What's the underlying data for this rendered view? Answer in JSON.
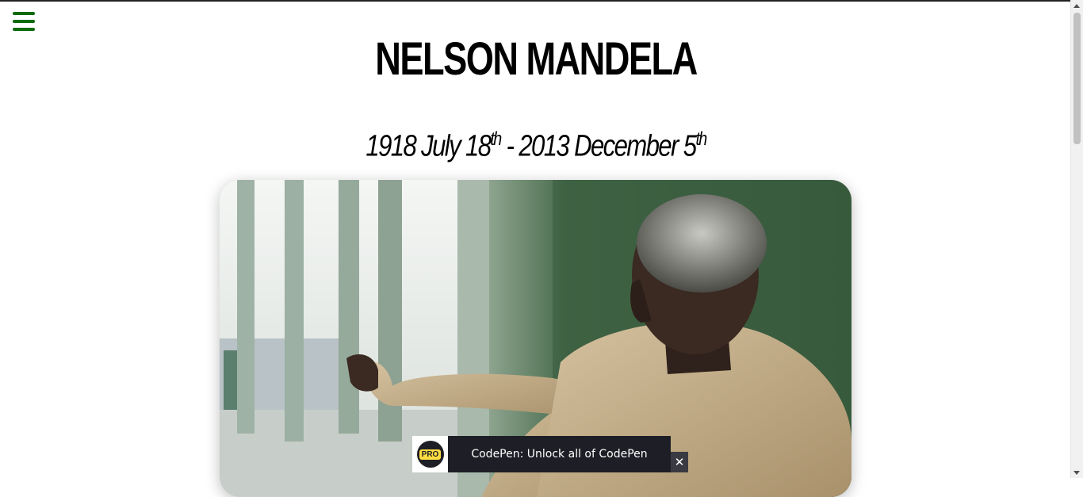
{
  "header": {
    "menu_icon": "hamburger-menu-icon",
    "title": "NELSON MANDELA",
    "dates": {
      "birth": "1918 July 18",
      "birth_suffix": "th",
      "separator": " - ",
      "death": "2013 December 5",
      "death_suffix": "th"
    }
  },
  "colors": {
    "menu_icon": "#0b6b0b",
    "text": "#000000",
    "promo_background": "#1e1f26",
    "promo_logo_accent": "#ffdd40"
  },
  "photo": {
    "subject": "portrait-photo"
  },
  "promo_banner": {
    "logo_label": "PRO",
    "text": "CodePen: Unlock all of CodePen",
    "close_icon": "close-icon"
  }
}
